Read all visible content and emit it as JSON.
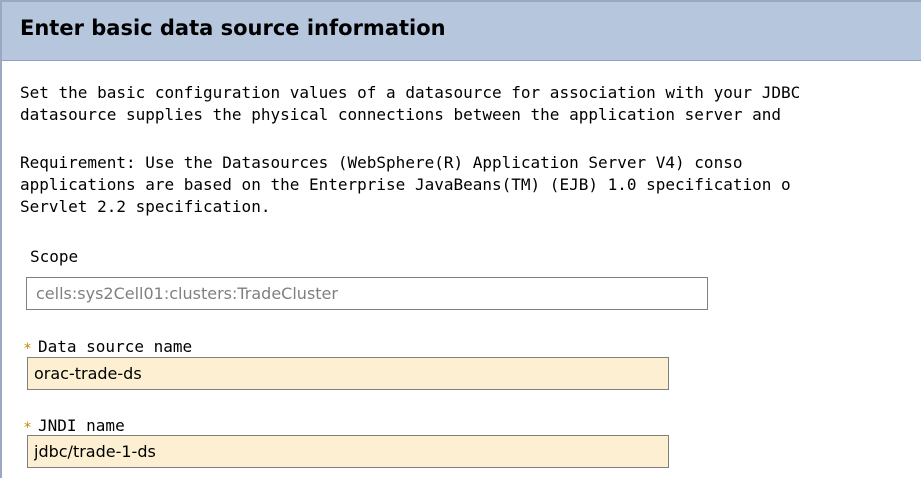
{
  "header": {
    "title": "Enter basic data source information"
  },
  "description": {
    "line1": "Set the basic configuration values of a datasource for association with your JDBC",
    "line2": "datasource supplies the physical connections between the application server and",
    "line3": "Requirement: Use the Datasources (WebSphere(R) Application Server V4) conso",
    "line4": "applications are based on the Enterprise JavaBeans(TM) (EJB) 1.0 specification o",
    "line5": "Servlet 2.2 specification."
  },
  "scope": {
    "label": "Scope",
    "value": "cells:sys2Cell01:clusters:TradeCluster"
  },
  "data_source_name": {
    "required_marker": "*",
    "label": "Data source name",
    "value": "orac-trade-ds"
  },
  "jndi_name": {
    "required_marker": "*",
    "label": "JNDI name",
    "value": "jdbc/trade-1-ds"
  },
  "colors": {
    "header_bg": "#b6c6dd",
    "required_field_bg": "#fdf0d2",
    "required_star": "#c08a00",
    "readonly_text": "#808080"
  }
}
